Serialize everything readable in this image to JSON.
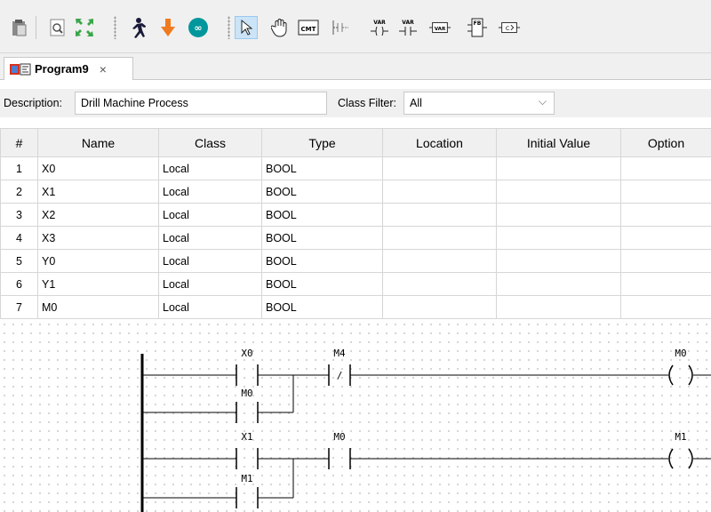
{
  "toolbar": {
    "icons": [
      "clipboard-icon",
      "zoom-icon",
      "fit-screen-icon",
      "run-icon",
      "download-icon",
      "arduino-icon",
      "pointer-icon",
      "hand-icon",
      "comment-icon",
      "contact-icon",
      "var-coil-icon",
      "var-contact-icon",
      "var-block-icon",
      "function-block-icon",
      "compare-icon"
    ],
    "cmt_label": "CMT",
    "var_label": "VAR",
    "fb_label": "FB",
    "c_label": "C"
  },
  "tab": {
    "label": "Program9",
    "close_glyph": "×"
  },
  "description": {
    "label": "Description:",
    "value": "Drill Machine Process",
    "class_filter_label": "Class Filter:",
    "class_filter_value": "All"
  },
  "table": {
    "headers": [
      "#",
      "Name",
      "Class",
      "Type",
      "Location",
      "Initial Value",
      "Option"
    ],
    "rows": [
      {
        "num": "1",
        "name": "X0",
        "class": "Local",
        "type": "BOOL",
        "location": "",
        "initial": "",
        "option": ""
      },
      {
        "num": "2",
        "name": "X1",
        "class": "Local",
        "type": "BOOL",
        "location": "",
        "initial": "",
        "option": ""
      },
      {
        "num": "3",
        "name": "X2",
        "class": "Local",
        "type": "BOOL",
        "location": "",
        "initial": "",
        "option": ""
      },
      {
        "num": "4",
        "name": "X3",
        "class": "Local",
        "type": "BOOL",
        "location": "",
        "initial": "",
        "option": ""
      },
      {
        "num": "5",
        "name": "Y0",
        "class": "Local",
        "type": "BOOL",
        "location": "",
        "initial": "",
        "option": ""
      },
      {
        "num": "6",
        "name": "Y1",
        "class": "Local",
        "type": "BOOL",
        "location": "",
        "initial": "",
        "option": ""
      },
      {
        "num": "7",
        "name": "M0",
        "class": "Local",
        "type": "BOOL",
        "location": "",
        "initial": "",
        "option": ""
      }
    ]
  },
  "ladder": {
    "rung1": {
      "contact": "X0",
      "parallel": "M0",
      "nc_contact": "M4",
      "coil": "M0"
    },
    "rung2": {
      "contact": "X1",
      "parallel": "M1",
      "no_contact": "M0",
      "coil": "M1"
    },
    "nc_symbol": "/"
  }
}
